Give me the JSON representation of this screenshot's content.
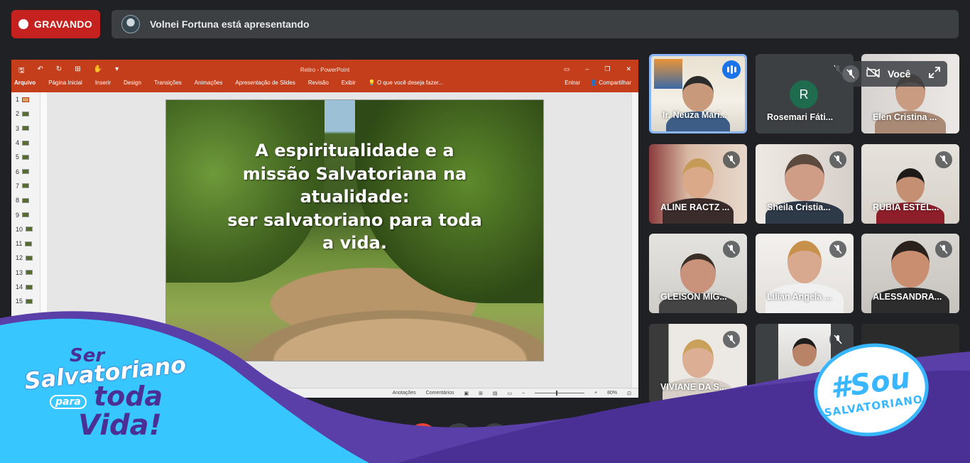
{
  "recording": {
    "label": "GRAVANDO"
  },
  "presenter": {
    "text": "Volnei Fortuna está apresentando"
  },
  "powerpoint": {
    "window_title": "Retiro - PowerPoint",
    "menu": [
      "Arquivo",
      "Página Inicial",
      "Inserir",
      "Design",
      "Transições",
      "Animações",
      "Apresentação de Slides",
      "Revisão",
      "Exibir"
    ],
    "tell_me": "O que você deseja fazer...",
    "sign_in": "Entrar",
    "share": "Compartilhar",
    "slide_numbers": [
      "1",
      "2",
      "3",
      "4",
      "5",
      "6",
      "7",
      "8",
      "9",
      "10",
      "11",
      "12",
      "13",
      "14",
      "15"
    ],
    "slide_text": "A espiritualidade e a\nmissão Salvatoriana na\natualidade:\nser salvatoriano para toda\na vida.",
    "status": {
      "notes": "Anotações",
      "comments": "Comentários",
      "zoom": "80%"
    }
  },
  "participants": [
    {
      "name": "Ir. Neuza Mari...",
      "speaking": true
    },
    {
      "name": "Rosemari Fáti...",
      "avatar_letter": "R",
      "muted": true
    },
    {
      "name": "Elen Cristina ...",
      "muted": true
    },
    {
      "name": "ALINE RACTZ ...",
      "muted": true
    },
    {
      "name": "Sheila Cristia...",
      "muted": true
    },
    {
      "name": "RUBIA ESTEL...",
      "muted": true
    },
    {
      "name": "GLEISON MIG...",
      "muted": true
    },
    {
      "name": "Lilian Angela ...",
      "muted": true
    },
    {
      "name": "ALESSANDRA...",
      "muted": true
    },
    {
      "name": "VIVIANE DA S...",
      "muted": true
    },
    {
      "name": "",
      "muted": true
    },
    {
      "name": "",
      "muted": false
    }
  ],
  "self_view": {
    "label": "Você"
  },
  "branding": {
    "left_line1": "Ser",
    "left_line2": "Salvatoriano",
    "left_para": "para",
    "left_toda": "toda",
    "left_vida": "Vida!",
    "right_hashtag": "#Sou",
    "right_word": "SALVATORIANO"
  },
  "colors": {
    "recording": "#c5221f",
    "ppt_accent": "#c43e1c",
    "speaking": "#1a73e8",
    "brand_cyan": "#38b6ff",
    "brand_purple": "#5b3fa8"
  }
}
